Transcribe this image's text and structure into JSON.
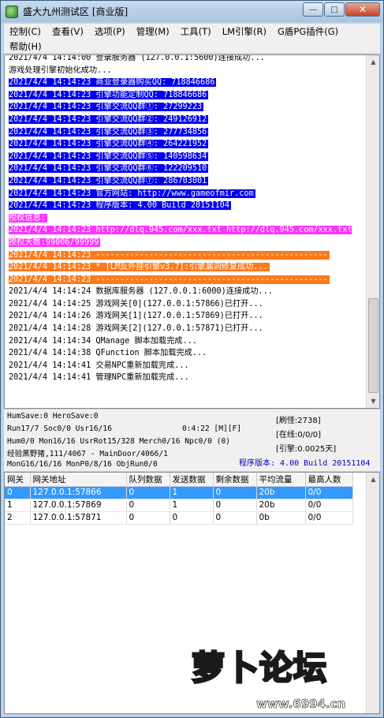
{
  "window": {
    "title": "盛大九州测试区 [商业版]"
  },
  "menubar": {
    "row1": [
      "控制(C)",
      "查看(V)",
      "选项(P)",
      "管理(M)",
      "工具(T)",
      "LM引擎(R)",
      "G盾PG插件(G)"
    ],
    "row2": [
      "帮助(H)"
    ]
  },
  "log": [
    {
      "text": "2021/4/4 14:14:00 登录服务器 (127.0.0.1:5600)连接成功...",
      "style": "plain"
    },
    {
      "text": "游戏处理引擎初始化成功...",
      "style": "plain"
    },
    {
      "text": "2021/4/4 14:14:23 商业登录器购买QQ: 718846686",
      "style": "blue"
    },
    {
      "text": "2021/4/4 14:14:23 引擎功能定制QQ: 718846686",
      "style": "blue"
    },
    {
      "text": "2021/4/4 14:14:23 引擎交流QQ群①: 27299223",
      "style": "blue"
    },
    {
      "text": "2021/4/4 14:14:23 引擎交流QQ群②: 249126912",
      "style": "blue"
    },
    {
      "text": "2021/4/4 14:14:23 引擎交流QQ群③: 277734856",
      "style": "blue"
    },
    {
      "text": "2021/4/4 14:14:23 引擎交流QQ群④: 264221952",
      "style": "blue"
    },
    {
      "text": "2021/4/4 14:14:23 引擎交流QQ群⑤: 140598634",
      "style": "blue"
    },
    {
      "text": "2021/4/4 14:14:23 引擎交流QQ群⑥: 122209510",
      "style": "blue"
    },
    {
      "text": "2021/4/4 14:14:23 引擎交流QQ群⑦: 286703001",
      "style": "blue"
    },
    {
      "text": "2021/4/4 14:14:23 官方网站: http://www.gameofmir.com",
      "style": "blue"
    },
    {
      "text": "2021/4/4 14:14:23 程序版本: 4.00 Build 20151104",
      "style": "blue"
    },
    {
      "text": "授权信息:",
      "style": "magenta"
    },
    {
      "text": "2021/4/4 14:14:23 http://dlq.945.com/xxx.txt http://dlq.945.com/xxx.txt 授权天数:99006/99999",
      "style": "magenta-wrap"
    },
    {
      "text": "2021/4/4 14:14:23 ------------------------------------------------",
      "style": "orange"
    },
    {
      "text": "2021/4/4 14:14:23 * [LM反外挂引擎v3.7]:引擎漏洞修复成功...",
      "style": "orange"
    },
    {
      "text": "2021/4/4 14:14:23 ------------------------------------------------",
      "style": "orange"
    },
    {
      "text": "2021/4/4 14:14:24 数据库服务器 (127.0.0.1:6000)连接成功...",
      "style": "plain"
    },
    {
      "text": "2021/4/4 14:14:25 游戏网关[0](127.0.0.1:57866)已打开...",
      "style": "plain"
    },
    {
      "text": "2021/4/4 14:14:26 游戏网关[1](127.0.0.1:57869)已打开...",
      "style": "plain"
    },
    {
      "text": "2021/4/4 14:14:28 游戏网关[2](127.0.0.1:57871)已打开...",
      "style": "plain"
    },
    {
      "text": "2021/4/4 14:14:34 QManage 脚本加载完成...",
      "style": "plain"
    },
    {
      "text": "2021/4/4 14:14:38 QFunction 脚本加载完成...",
      "style": "plain"
    },
    {
      "text": "2021/4/4 14:14:41 交易NPC重新加载完成...",
      "style": "plain"
    },
    {
      "text": "2021/4/4 14:14:41 管理NPC重新加载完成...",
      "style": "plain"
    }
  ],
  "status": {
    "line1": "HumSave:0 HeroSave:0",
    "line2": "Run17/7 Soc0/0 Usr16/16",
    "time": "0:4:22 [M][F]",
    "line3": "Hum0/0 Mon16/16 UsrRot15/328 Merch0/16 Npc0/0 (0)",
    "line4": "经验黑野猪,111/4067 - MainDoor/4066/1",
    "line5": "MonG16/16/16 MonP0/8/16 ObjRun0/0",
    "refresh": "[刷怪:2738]",
    "online": "[在线:0/0/0]",
    "engine": "[引擎:0.0025天]",
    "version": "程序版本: 4.00 Build 20151104"
  },
  "table": {
    "headers": [
      "网关",
      "网关地址",
      "队列数据",
      "发送数据",
      "剩余数据",
      "平均流量",
      "最高人数"
    ],
    "rows": [
      [
        "0",
        "127.0.0.1:57866",
        "0",
        "1",
        "0",
        "20b",
        "0/0"
      ],
      [
        "1",
        "127.0.0.1:57869",
        "0",
        "1",
        "0",
        "20b",
        "0/0"
      ],
      [
        "2",
        "127.0.0.1:57871",
        "0",
        "0",
        "0",
        "0b",
        "0/0"
      ]
    ],
    "selected_row": 0
  },
  "watermark": {
    "brand": "萝卜论坛",
    "url": "www.6994.cn"
  }
}
